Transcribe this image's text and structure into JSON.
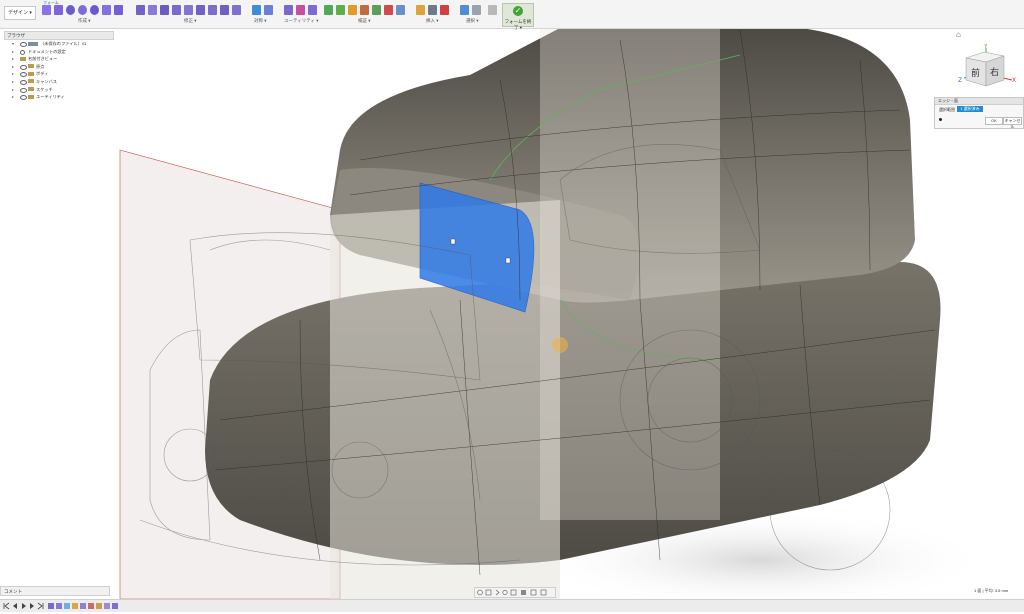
{
  "toolbar": {
    "workspace_label": "デザイン ▾",
    "mode_tab": "フォーム",
    "groups": [
      "作成 ▾",
      "修正 ▾",
      "対称 ▾",
      "ユーティリティ ▾",
      "検証 ▾",
      "挿入 ▾",
      "選択 ▾"
    ],
    "finish_label": "フォームを終了 ▾"
  },
  "browser": {
    "header": "ブラウザ",
    "items": [
      {
        "label": "（未保存のファイル）v1",
        "kind": "root"
      },
      {
        "label": "ドキュメントの設定",
        "kind": "settings"
      },
      {
        "label": "名前付きビュー",
        "kind": "folder"
      },
      {
        "label": "原点",
        "kind": "folder"
      },
      {
        "label": "ボディ",
        "kind": "folder"
      },
      {
        "label": "キャンバス",
        "kind": "folder"
      },
      {
        "label": "スケッチ",
        "kind": "folder"
      },
      {
        "label": "ユーティリティ",
        "kind": "folder"
      }
    ]
  },
  "viewcube": {
    "front": "前",
    "right": "右",
    "axis_x": "X",
    "axis_y": "Y",
    "axis_z": "Z"
  },
  "edit_panel": {
    "title": "エッジ・面",
    "field_label": "選択範囲",
    "field_value": "1 選択済み",
    "ok_label": "OK",
    "cancel_label": "キャンセル"
  },
  "comments_label": "コメント",
  "status_text": "1 面 | 平均: 3.5 mm",
  "colors": {
    "accent": "#1c8fd3",
    "selection_face": "#2f7be8",
    "body": "#6e6a62"
  }
}
